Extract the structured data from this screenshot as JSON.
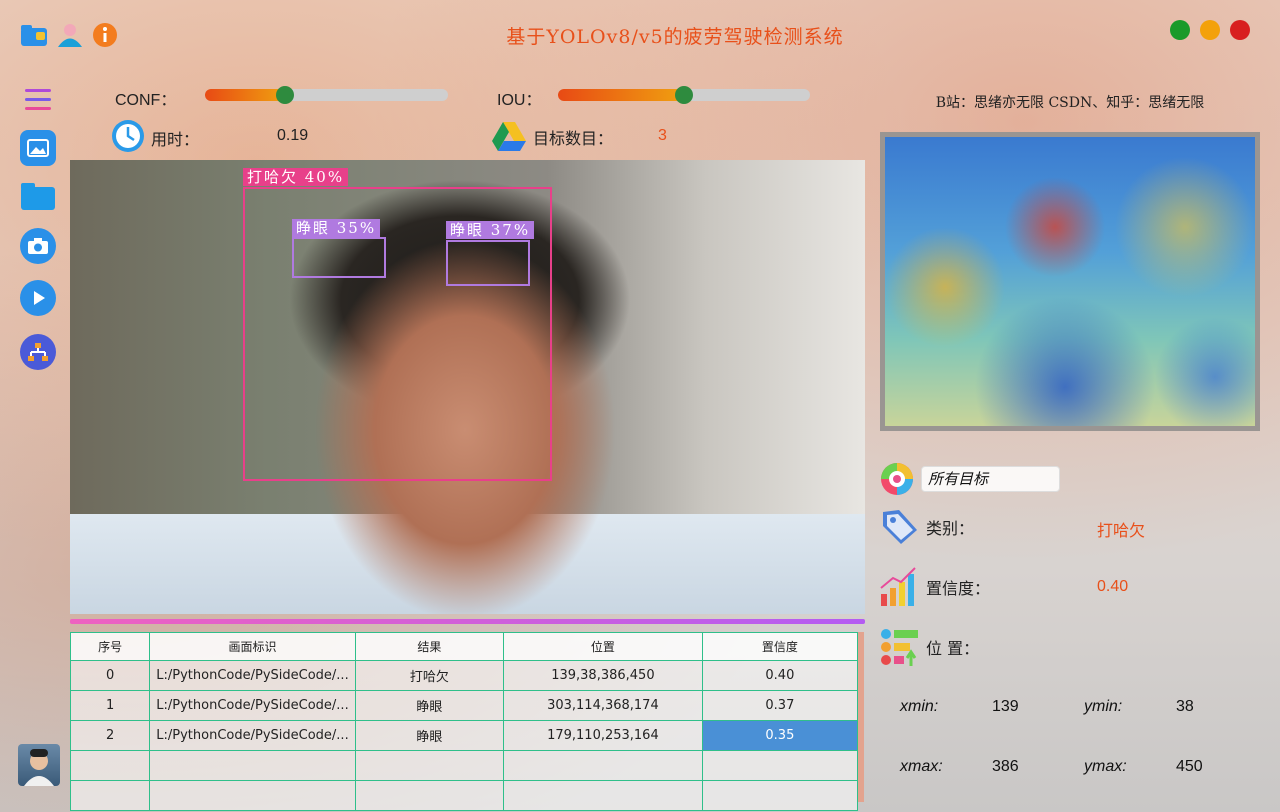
{
  "header": {
    "title": "基于YOLOv8/v5的疲劳驾驶检测系统",
    "window_colors": [
      "#1a9a2a",
      "#f3a10a",
      "#d81f1f"
    ]
  },
  "icons": {
    "logo": "folder-person-icon",
    "user": "user-group-icon",
    "info": "info-icon",
    "menu": "menu-icon",
    "image": "image-icon",
    "folder": "folder-icon",
    "camera": "camera-icon",
    "play": "play-icon",
    "model": "model-tree-icon",
    "clock": "clock-icon",
    "drive": "drive-icon",
    "palette": "palette-icon",
    "tag": "tag-icon",
    "chart": "bar-chart-icon",
    "position": "position-icon"
  },
  "controls": {
    "conf_label": "CONF：",
    "conf_value": 0.33,
    "iou_label": "IOU：",
    "iou_value": 0.5,
    "time_label": "用时：",
    "time_value": "0.19",
    "count_label": "目标数目：",
    "count_value": "3"
  },
  "credit": "B站：思绪亦无限 CSDN、知乎：思绪无限",
  "detections": [
    {
      "label": "打哈欠 40%",
      "color": "#e8408a"
    },
    {
      "label": "睁眼 35%",
      "color": "#b07ae0"
    },
    {
      "label": "睁眼 37%",
      "color": "#b07ae0"
    }
  ],
  "table": {
    "headers": [
      "序号",
      "画面标识",
      "结果",
      "位置",
      "置信度"
    ],
    "rows": [
      [
        "0",
        "L:/PythonCode/PySideCode/...",
        "打哈欠",
        "139,38,386,450",
        "0.40"
      ],
      [
        "1",
        "L:/PythonCode/PySideCode/...",
        "睁眼",
        "303,114,368,174",
        "0.37"
      ],
      [
        "2",
        "L:/PythonCode/PySideCode/...",
        "睁眼",
        "179,110,253,164",
        "0.35"
      ],
      [
        "",
        "",
        "",
        "",
        ""
      ],
      [
        "",
        "",
        "",
        "",
        ""
      ]
    ]
  },
  "details": {
    "target_select": "所有目标",
    "class_label": "类别：",
    "class_value": "打哈欠",
    "conf_label": "置信度：",
    "conf_value": "0.40",
    "pos_label": "位 置：",
    "xmin_label": "xmin:",
    "xmin_value": "139",
    "ymin_label": "ymin:",
    "ymin_value": "38",
    "xmax_label": "xmax:",
    "xmax_value": "386",
    "ymax_label": "ymax:",
    "ymax_value": "450"
  }
}
